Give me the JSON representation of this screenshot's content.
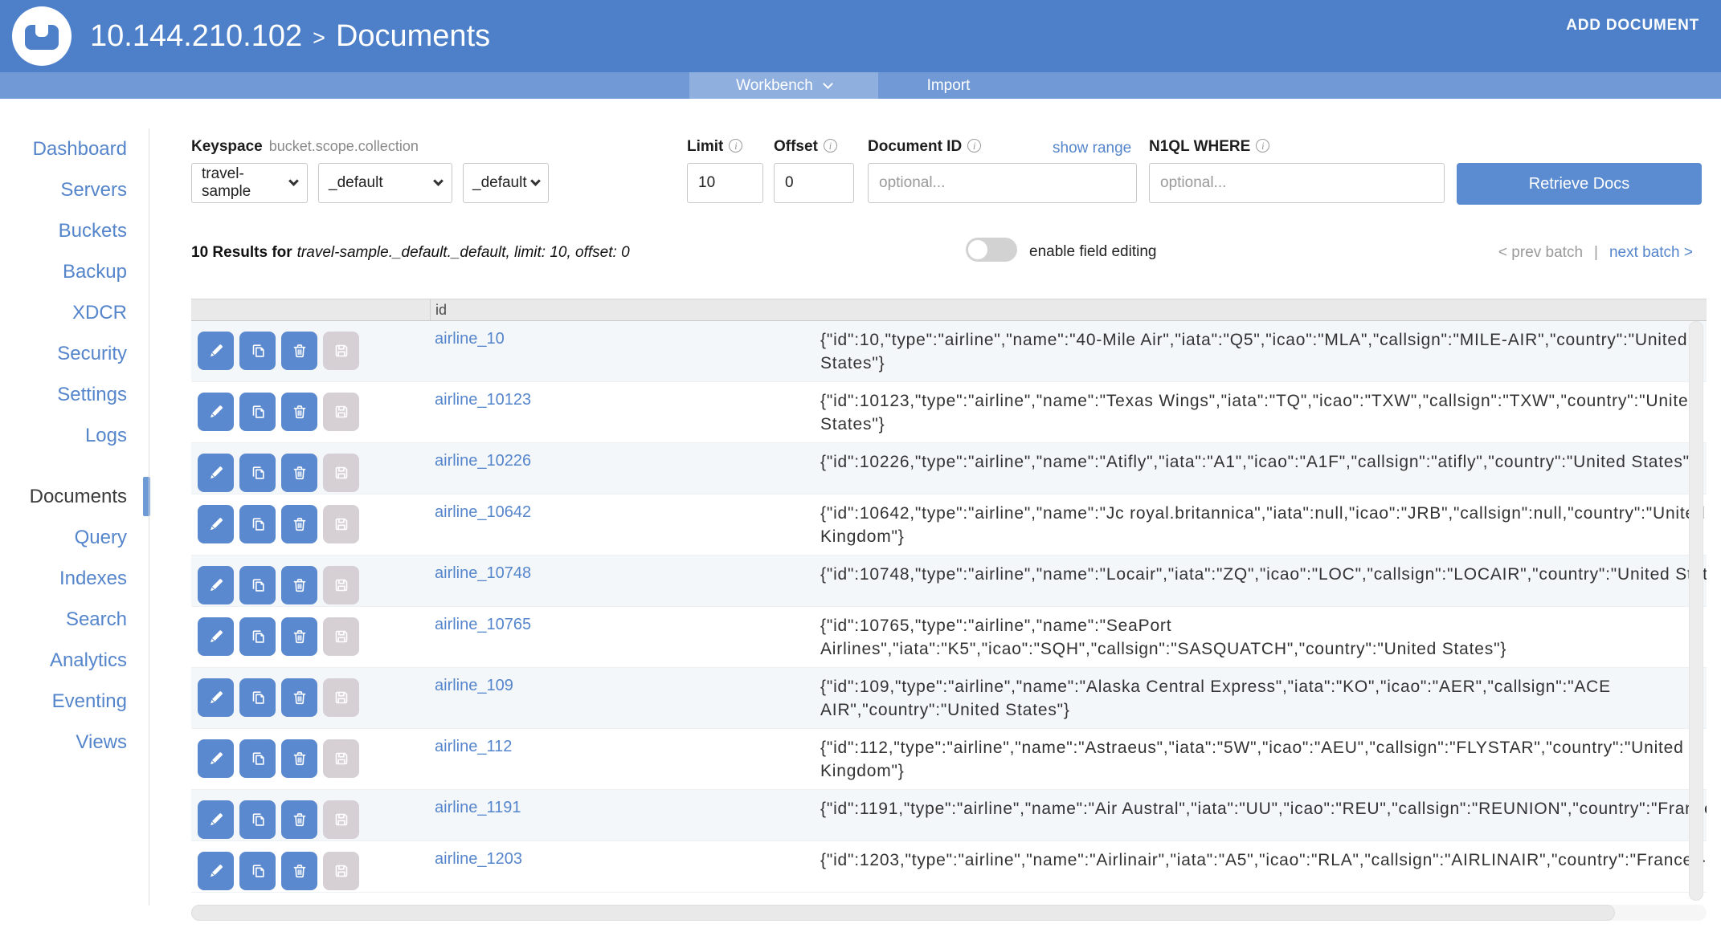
{
  "colors": {
    "header_blue": "#4e80c9",
    "tabbar_blue": "#7199d6",
    "active_tab_blue": "#8fafdf",
    "link_blue": "#5585cb",
    "button_blue": "#5b89cf",
    "disabled_button_gray": "#d6d0d4",
    "row_alt_background": "#f4f7fa",
    "table_header_gray": "#e9e9e9"
  },
  "icons": {
    "logo": "couchbase-logo",
    "tab_caret": "chevron-down-icon",
    "select_caret": "chevron-down-icon",
    "info": "info-icon",
    "row_actions": [
      "pencil-icon",
      "copy-icon",
      "trash-icon",
      "floppy-icon"
    ]
  },
  "header": {
    "host": "10.144.210.102",
    "separator": ">",
    "page": "Documents",
    "add_document": "ADD DOCUMENT"
  },
  "tabbar": {
    "workbench_label": "Workbench",
    "import_label": "Import"
  },
  "sidebar": {
    "items": [
      {
        "label": "Dashboard"
      },
      {
        "label": "Servers"
      },
      {
        "label": "Buckets"
      },
      {
        "label": "Backup"
      },
      {
        "label": "XDCR"
      },
      {
        "label": "Security"
      },
      {
        "label": "Settings"
      },
      {
        "label": "Logs"
      },
      {
        "label": "Documents",
        "active": true,
        "section_break": true
      },
      {
        "label": "Query"
      },
      {
        "label": "Indexes"
      },
      {
        "label": "Search"
      },
      {
        "label": "Analytics"
      },
      {
        "label": "Eventing"
      },
      {
        "label": "Views"
      }
    ]
  },
  "toolbar": {
    "keyspace_label": "Keyspace",
    "keyspace_hint": "bucket.scope.collection",
    "bucket": "travel-sample",
    "scope": "_default",
    "collection": "_default",
    "limit_label": "Limit",
    "limit_value": "10",
    "offset_label": "Offset",
    "offset_value": "0",
    "document_id_label": "Document ID",
    "document_id_placeholder": "optional...",
    "show_range_label": "show range",
    "n1ql_label": "N1QL WHERE",
    "n1ql_placeholder": "optional...",
    "retrieve_label": "Retrieve Docs"
  },
  "results": {
    "count_text": "10 Results for",
    "detail_text": "travel-sample._default._default, limit: 10, offset: 0",
    "toggle_label": "enable field editing",
    "prev_label": "< prev batch",
    "divider": "|",
    "next_label": "next batch >"
  },
  "table": {
    "id_header": "id",
    "rows": [
      {
        "id": "airline_10",
        "content": "{\"id\":10,\"type\":\"airline\",\"name\":\"40-Mile Air\",\"iata\":\"Q5\",\"icao\":\"MLA\",\"callsign\":\"MILE-AIR\",\"country\":\"United States\"}"
      },
      {
        "id": "airline_10123",
        "content": "{\"id\":10123,\"type\":\"airline\",\"name\":\"Texas Wings\",\"iata\":\"TQ\",\"icao\":\"TXW\",\"callsign\":\"TXW\",\"country\":\"United States\"}"
      },
      {
        "id": "airline_10226",
        "content": "{\"id\":10226,\"type\":\"airline\",\"name\":\"Atifly\",\"iata\":\"A1\",\"icao\":\"A1F\",\"callsign\":\"atifly\",\"country\":\"United States\"}"
      },
      {
        "id": "airline_10642",
        "content": "{\"id\":10642,\"type\":\"airline\",\"name\":\"Jc royal.britannica\",\"iata\":null,\"icao\":\"JRB\",\"callsign\":null,\"country\":\"United Kingdom\"}"
      },
      {
        "id": "airline_10748",
        "content": "{\"id\":10748,\"type\":\"airline\",\"name\":\"Locair\",\"iata\":\"ZQ\",\"icao\":\"LOC\",\"callsign\":\"LOCAIR\",\"country\":\"United States\"}"
      },
      {
        "id": "airline_10765",
        "content": "{\"id\":10765,\"type\":\"airline\",\"name\":\"SeaPort Airlines\",\"iata\":\"K5\",\"icao\":\"SQH\",\"callsign\":\"SASQUATCH\",\"country\":\"United States\"}"
      },
      {
        "id": "airline_109",
        "content": "{\"id\":109,\"type\":\"airline\",\"name\":\"Alaska Central Express\",\"iata\":\"KO\",\"icao\":\"AER\",\"callsign\":\"ACE AIR\",\"country\":\"United States\"}"
      },
      {
        "id": "airline_112",
        "content": "{\"id\":112,\"type\":\"airline\",\"name\":\"Astraeus\",\"iata\":\"5W\",\"icao\":\"AEU\",\"callsign\":\"FLYSTAR\",\"country\":\"United Kingdom\"}"
      },
      {
        "id": "airline_1191",
        "content": "{\"id\":1191,\"type\":\"airline\",\"name\":\"Air Austral\",\"iata\":\"UU\",\"icao\":\"REU\",\"callsign\":\"REUNION\",\"country\":\"France\"}"
      },
      {
        "id": "airline_1203",
        "content": "{\"id\":1203,\"type\":\"airline\",\"name\":\"Airlinair\",\"iata\":\"A5\",\"icao\":\"RLA\",\"callsign\":\"AIRLINAIR\",\"country\":\"France\"}"
      }
    ]
  }
}
